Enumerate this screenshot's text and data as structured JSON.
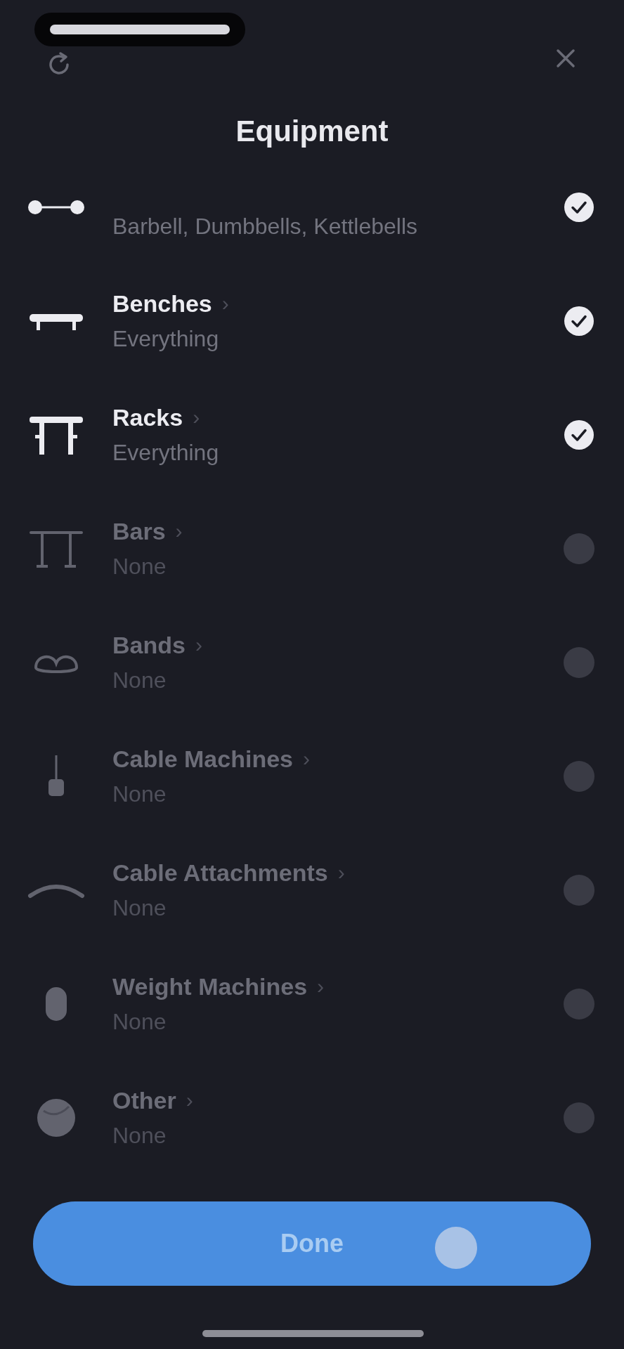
{
  "header": {
    "title": "Equipment"
  },
  "items": [
    {
      "kind": "free_weights",
      "subtitle": "Barbell, Dumbbells, Kettlebells",
      "checked": true
    },
    {
      "kind": "benches",
      "title": "Benches",
      "chevron": "›",
      "subtitle": "Everything",
      "checked": true
    },
    {
      "kind": "racks",
      "title": "Racks",
      "chevron": "›",
      "subtitle": "Everything",
      "checked": true
    },
    {
      "kind": "bars",
      "title": "Bars",
      "chevron": "›",
      "subtitle": "None",
      "checked": false
    },
    {
      "kind": "bands",
      "title": "Bands",
      "chevron": "›",
      "subtitle": "None",
      "checked": false
    },
    {
      "kind": "cable_machines",
      "title": "Cable Machines",
      "chevron": "›",
      "subtitle": "None",
      "checked": false
    },
    {
      "kind": "cable_attachments",
      "title": "Cable Attachments",
      "chevron": "›",
      "subtitle": "None",
      "checked": false
    },
    {
      "kind": "weight_machines",
      "title": "Weight Machines",
      "chevron": "›",
      "subtitle": "None",
      "checked": false
    },
    {
      "kind": "other",
      "title": "Other",
      "chevron": "›",
      "subtitle": "None",
      "checked": false
    }
  ],
  "done_button": {
    "label": "Done"
  }
}
